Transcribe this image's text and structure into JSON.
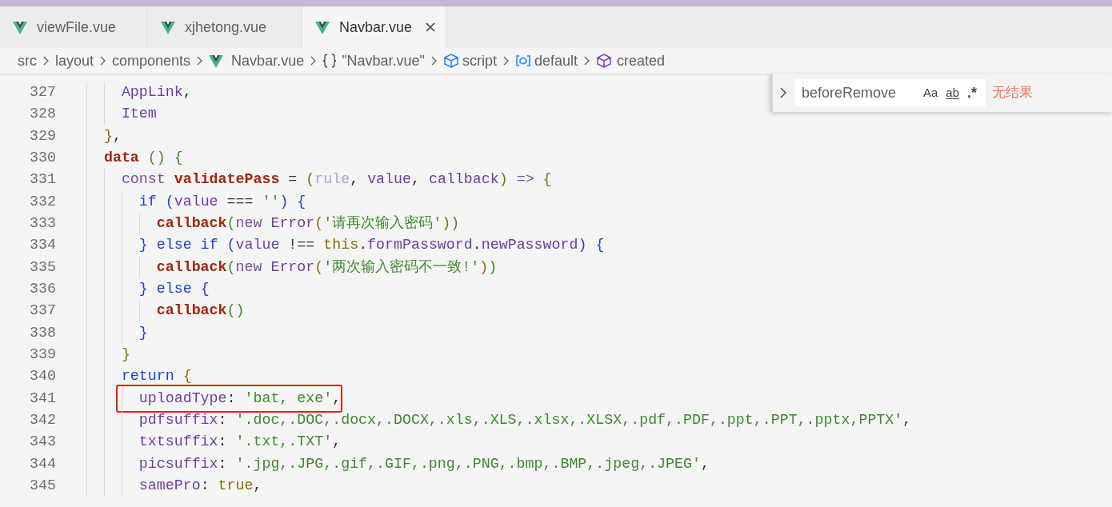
{
  "tabs": [
    {
      "label": "viewFile.vue",
      "selected": false
    },
    {
      "label": "xjhetong.vue",
      "selected": false
    },
    {
      "label": "Navbar.vue",
      "selected": true
    }
  ],
  "breadcrumb": [
    {
      "label": "src",
      "kind": "folder"
    },
    {
      "label": "layout",
      "kind": "folder"
    },
    {
      "label": "components",
      "kind": "folder"
    },
    {
      "label": "Navbar.vue",
      "kind": "file"
    },
    {
      "label": "\"Navbar.vue\"",
      "kind": "object"
    },
    {
      "label": "script",
      "kind": "module"
    },
    {
      "label": "default",
      "kind": "variable"
    },
    {
      "label": "created",
      "kind": "method"
    }
  ],
  "find_widget": {
    "value": "beforeRemove",
    "options": [
      "Aa",
      "ab",
      ".*"
    ],
    "result": "无结果"
  },
  "lines": [
    {
      "number": "327",
      "highlighted": false,
      "tokens": [
        {
          "text": "    AppLink",
          "kind": "ident"
        },
        {
          "text": ",",
          "kind": "plain"
        }
      ]
    },
    {
      "number": "328",
      "highlighted": false,
      "tokens": [
        {
          "text": "    Item",
          "kind": "ident"
        }
      ]
    },
    {
      "number": "329",
      "highlighted": false,
      "tokens": [
        {
          "text": "  }",
          "kind": "paren1"
        },
        {
          "text": ",",
          "kind": "plain"
        }
      ]
    },
    {
      "number": "330",
      "highlighted": false,
      "tokens": [
        {
          "text": "  data",
          "kind": "func"
        },
        {
          "text": " ()",
          "kind": "paren2"
        },
        {
          "text": " {",
          "kind": "paren2"
        }
      ]
    },
    {
      "number": "331",
      "highlighted": false,
      "tokens": [
        {
          "text": "    const",
          "kind": "keyword"
        },
        {
          "text": " validatePass",
          "kind": "func"
        },
        {
          "text": " =",
          "kind": "plain"
        },
        {
          "text": " (",
          "kind": "paren1"
        },
        {
          "text": "rule",
          "kind": "faded"
        },
        {
          "text": ",",
          "kind": "plain"
        },
        {
          "text": " value",
          "kind": "ident"
        },
        {
          "text": ",",
          "kind": "plain"
        },
        {
          "text": " callback",
          "kind": "ident"
        },
        {
          "text": ")",
          "kind": "paren1"
        },
        {
          "text": " =>",
          "kind": "keyword"
        },
        {
          "text": " {",
          "kind": "paren1"
        }
      ]
    },
    {
      "number": "332",
      "highlighted": false,
      "tokens": [
        {
          "text": "      if",
          "kind": "control"
        },
        {
          "text": " (",
          "kind": "paren3"
        },
        {
          "text": "value",
          "kind": "ident"
        },
        {
          "text": " ===",
          "kind": "plain"
        },
        {
          "text": " ''",
          "kind": "string"
        },
        {
          "text": ")",
          "kind": "paren3"
        },
        {
          "text": " {",
          "kind": "paren3"
        }
      ]
    },
    {
      "number": "333",
      "highlighted": false,
      "tokens": [
        {
          "text": "        callback",
          "kind": "func"
        },
        {
          "text": "(",
          "kind": "paren2"
        },
        {
          "text": "new",
          "kind": "keyword"
        },
        {
          "text": " Error",
          "kind": "ident"
        },
        {
          "text": "(",
          "kind": "paren1"
        },
        {
          "text": "'请再次输入密码'",
          "kind": "string"
        },
        {
          "text": ")",
          "kind": "paren1"
        },
        {
          "text": ")",
          "kind": "paren2"
        }
      ]
    },
    {
      "number": "334",
      "highlighted": false,
      "tokens": [
        {
          "text": "      }",
          "kind": "paren3"
        },
        {
          "text": " else if",
          "kind": "control"
        },
        {
          "text": " (",
          "kind": "paren3"
        },
        {
          "text": "value",
          "kind": "ident"
        },
        {
          "text": " !==",
          "kind": "plain"
        },
        {
          "text": " this",
          "kind": "this"
        },
        {
          "text": ".",
          "kind": "plain"
        },
        {
          "text": "formPassword",
          "kind": "ident"
        },
        {
          "text": ".",
          "kind": "plain"
        },
        {
          "text": "newPassword",
          "kind": "ident"
        },
        {
          "text": ")",
          "kind": "paren3"
        },
        {
          "text": " {",
          "kind": "paren3"
        }
      ]
    },
    {
      "number": "335",
      "highlighted": false,
      "tokens": [
        {
          "text": "        callback",
          "kind": "func"
        },
        {
          "text": "(",
          "kind": "paren2"
        },
        {
          "text": "new",
          "kind": "keyword"
        },
        {
          "text": " Error",
          "kind": "ident"
        },
        {
          "text": "(",
          "kind": "paren1"
        },
        {
          "text": "'两次输入密码不一致!'",
          "kind": "string"
        },
        {
          "text": ")",
          "kind": "paren1"
        },
        {
          "text": ")",
          "kind": "paren2"
        }
      ]
    },
    {
      "number": "336",
      "highlighted": false,
      "tokens": [
        {
          "text": "      }",
          "kind": "paren3"
        },
        {
          "text": " else",
          "kind": "control"
        },
        {
          "text": " {",
          "kind": "paren3"
        }
      ]
    },
    {
      "number": "337",
      "highlighted": false,
      "tokens": [
        {
          "text": "        callback",
          "kind": "func"
        },
        {
          "text": "()",
          "kind": "paren2"
        }
      ]
    },
    {
      "number": "338",
      "highlighted": false,
      "tokens": [
        {
          "text": "      }",
          "kind": "paren3"
        }
      ]
    },
    {
      "number": "339",
      "highlighted": false,
      "tokens": [
        {
          "text": "    }",
          "kind": "paren1"
        }
      ]
    },
    {
      "number": "340",
      "highlighted": false,
      "tokens": [
        {
          "text": "    return",
          "kind": "control"
        },
        {
          "text": " {",
          "kind": "paren1"
        }
      ]
    },
    {
      "number": "341",
      "highlighted": true,
      "tokens": [
        {
          "text": "      uploadType",
          "kind": "ident"
        },
        {
          "text": ":",
          "kind": "plain"
        },
        {
          "text": " 'bat, exe'",
          "kind": "string"
        },
        {
          "text": ",",
          "kind": "plain"
        }
      ]
    },
    {
      "number": "342",
      "highlighted": false,
      "tokens": [
        {
          "text": "      pdfsuffix",
          "kind": "ident"
        },
        {
          "text": ":",
          "kind": "plain"
        },
        {
          "text": " '.doc,.DOC,.docx,.DOCX,.xls,.XLS,.xlsx,.XLSX,.pdf,.PDF,.ppt,.PPT,.pptx,PPTX'",
          "kind": "string"
        },
        {
          "text": ",",
          "kind": "plain"
        }
      ]
    },
    {
      "number": "343",
      "highlighted": false,
      "tokens": [
        {
          "text": "      txtsuffix",
          "kind": "ident"
        },
        {
          "text": ":",
          "kind": "plain"
        },
        {
          "text": " '.txt,.TXT'",
          "kind": "string"
        },
        {
          "text": ",",
          "kind": "plain"
        }
      ]
    },
    {
      "number": "344",
      "highlighted": false,
      "tokens": [
        {
          "text": "      picsuffix",
          "kind": "ident"
        },
        {
          "text": ":",
          "kind": "plain"
        },
        {
          "text": " '.jpg,.JPG,.gif,.GIF,.png,.PNG,.bmp,.BMP,.jpeg,.JPEG'",
          "kind": "string"
        },
        {
          "text": ",",
          "kind": "plain"
        }
      ]
    },
    {
      "number": "345",
      "highlighted": false,
      "tokens": [
        {
          "text": "      samePro",
          "kind": "ident"
        },
        {
          "text": ":",
          "kind": "plain"
        },
        {
          "text": " true",
          "kind": "this"
        },
        {
          "text": ",",
          "kind": "plain"
        }
      ]
    }
  ]
}
